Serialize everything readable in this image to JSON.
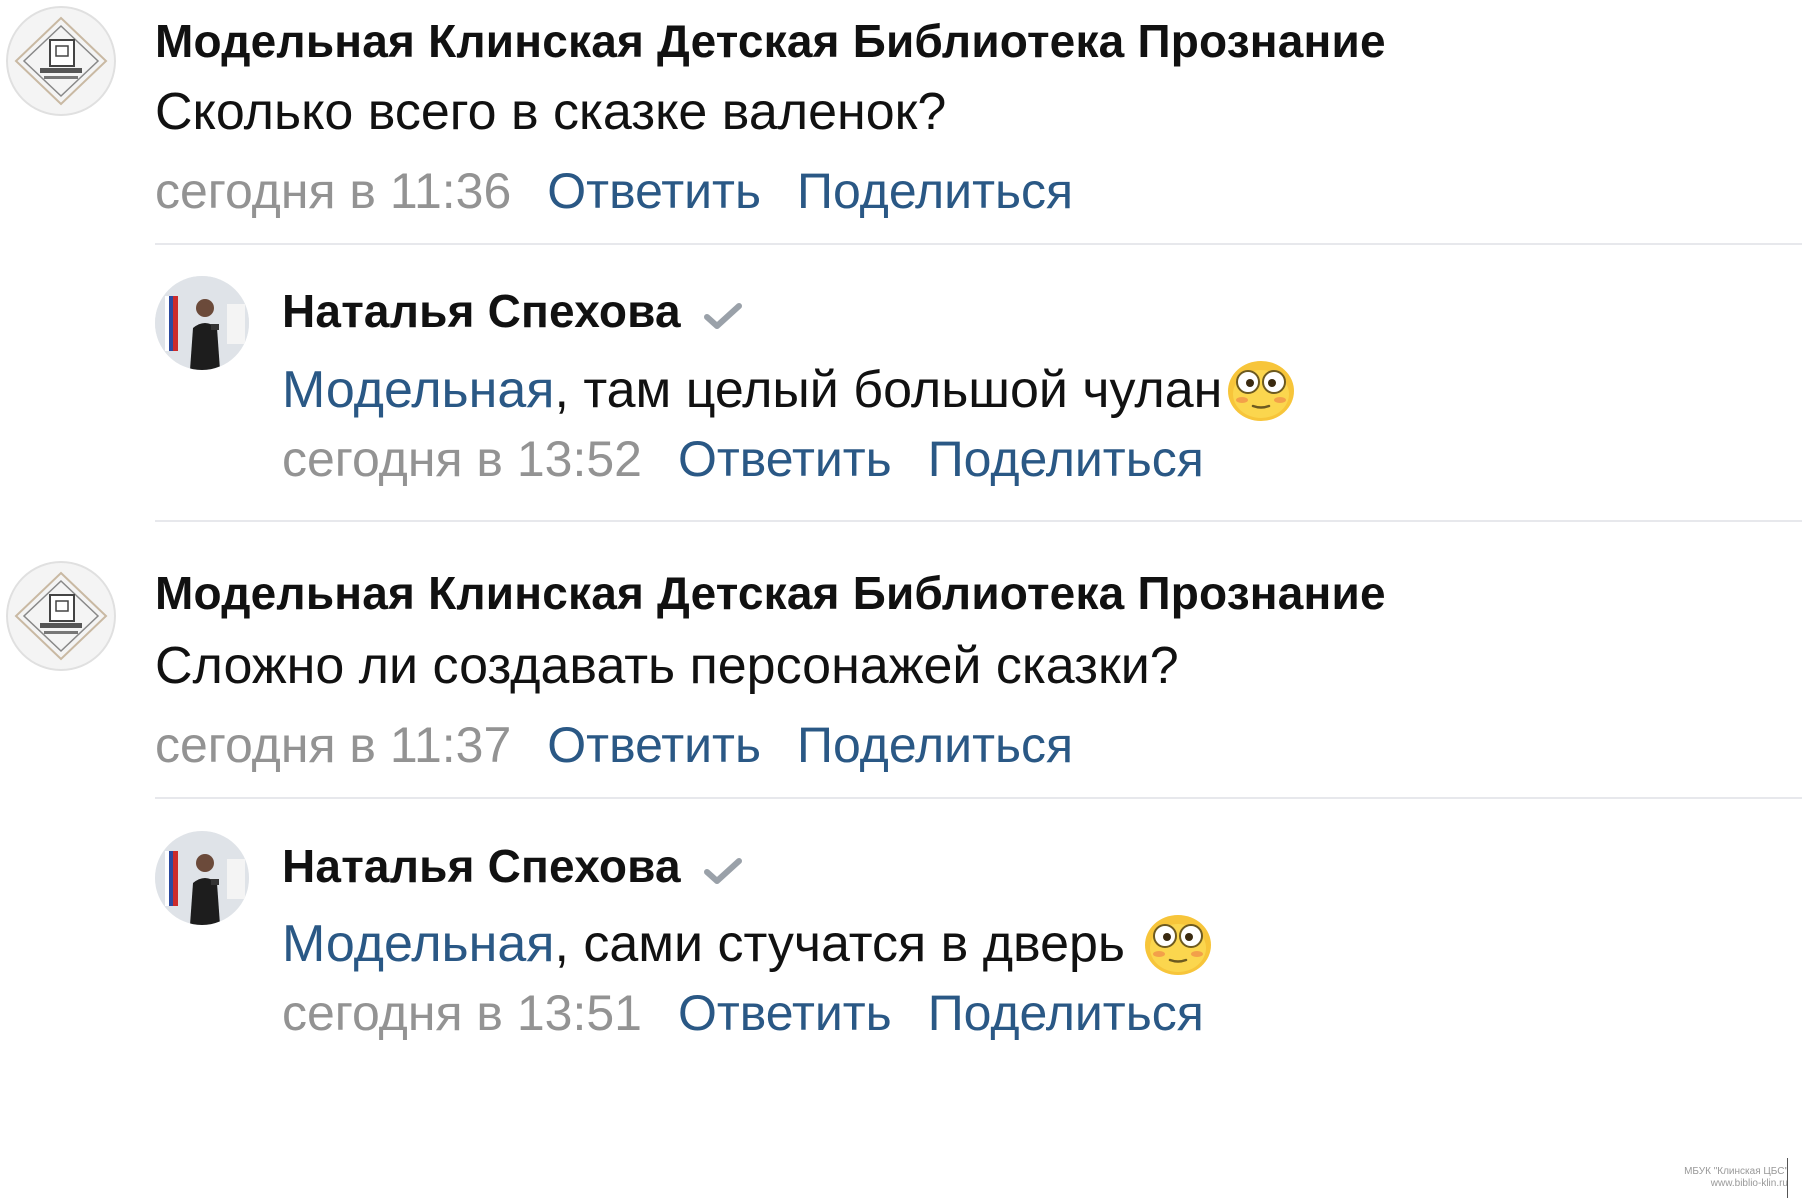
{
  "colors": {
    "link": "#2a5885",
    "date": "#939393",
    "divider": "#e7e8ec"
  },
  "comments": [
    {
      "author": "Модельная Клинская Детская Библиотека Прознание",
      "text": "Сколько всего в сказке валенок?",
      "date": "сегодня в 11:36",
      "reply_label": "Ответить",
      "share_label": "Поделиться",
      "avatar_icon": "library-logo-icon"
    },
    {
      "author": "Наталья Спехова",
      "mention": "Модельная",
      "text": ", там целый большой чулан",
      "date": "сегодня в 13:52",
      "reply_label": "Ответить",
      "share_label": "Поделиться",
      "avatar_icon": "user-photo-icon",
      "emoji": "flushed-face-emoji"
    },
    {
      "author": "Модельная Клинская Детская Библиотека Прознание",
      "text": "Сложно ли создавать персонажей сказки?",
      "date": "сегодня в 11:37",
      "reply_label": "Ответить",
      "share_label": "Поделиться",
      "avatar_icon": "library-logo-icon"
    },
    {
      "author": "Наталья Спехова",
      "mention": "Модельная",
      "text": ", сами стучатся в дверь ",
      "date": "сегодня в 13:51",
      "reply_label": "Ответить",
      "share_label": "Поделиться",
      "avatar_icon": "user-photo-icon",
      "emoji": "flushed-face-emoji"
    }
  ],
  "watermark": {
    "line1": "МБУК \"Клинская ЦБС\"",
    "line2": "www.biblio-klin.ru"
  }
}
